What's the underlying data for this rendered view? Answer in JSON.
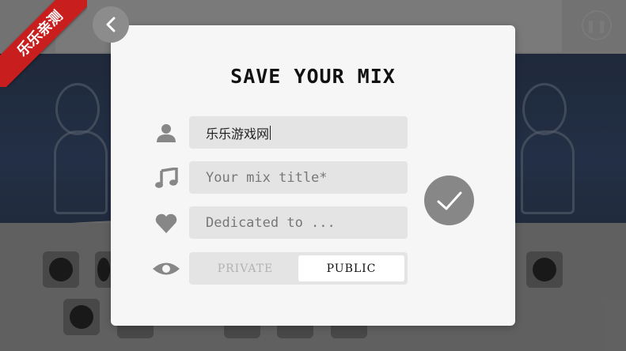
{
  "badge": {
    "text": "乐乐亲测"
  },
  "modal": {
    "title": "SAVE YOUR MIX",
    "fields": {
      "name": {
        "value": "乐乐游戏网",
        "icon": "user-icon"
      },
      "mix_title": {
        "placeholder": "Your mix title*",
        "icon": "music-note-icon"
      },
      "dedication": {
        "placeholder": "Dedicated to ...",
        "icon": "heart-icon"
      }
    },
    "visibility": {
      "icon": "eye-icon",
      "options": [
        "PRIVATE",
        "PUBLIC"
      ],
      "selected": "PUBLIC"
    }
  },
  "controls": {
    "back": "chevron-left-icon",
    "pause": "pause-icon",
    "confirm": "check-icon"
  },
  "colors": {
    "badge_red": "#c81e1e",
    "modal_bg": "#f6f6f6",
    "field_bg": "#e4e4e4",
    "icon_grey": "#878787"
  }
}
